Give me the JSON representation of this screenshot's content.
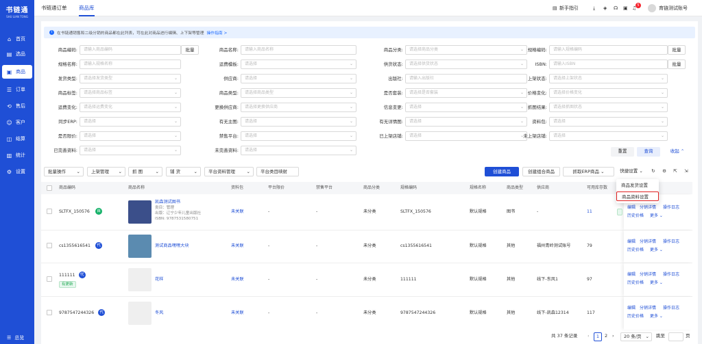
{
  "app": {
    "logo": "书链通",
    "logo_sub": "SHU LIAN TONG"
  },
  "sidebar": {
    "items": [
      {
        "label": "首页",
        "icon": "home-icon"
      },
      {
        "label": "选品",
        "icon": "select-icon"
      },
      {
        "label": "商品",
        "icon": "goods-icon"
      },
      {
        "label": "订单",
        "icon": "order-icon"
      },
      {
        "label": "售后",
        "icon": "aftersale-icon"
      },
      {
        "label": "客户",
        "icon": "customer-icon"
      },
      {
        "label": "结算",
        "icon": "settle-icon"
      },
      {
        "label": "统计",
        "icon": "stats-icon"
      },
      {
        "label": "设置",
        "icon": "settings-icon"
      }
    ],
    "active": "商品",
    "collapse_label": "总览"
  },
  "topbar": {
    "tabs": [
      "书链通订单",
      "商品库"
    ],
    "active_tab": "商品库",
    "guide": "新手指引",
    "notification_count": "5",
    "account": "育链测试账号"
  },
  "tip": {
    "text": "在书链通销售和二级分销的商品都在此列表，可在此对商品进行编辑、上下架等管理",
    "link": "操作指南 >"
  },
  "filters": {
    "rows": [
      [
        {
          "label": "商品编码:",
          "placeholder": "请输入商品编码",
          "extra": "批量"
        },
        {
          "label": "商品名称:",
          "placeholder": "请输入商品名称"
        },
        {
          "label": "商品分类:",
          "placeholder": "请选择商品分类",
          "dd": true
        },
        {
          "label": "规格编码:",
          "placeholder": "请输入规格编码",
          "extra": "批量"
        }
      ],
      [
        {
          "label": "规格名称:",
          "placeholder": "请输入规格名称"
        },
        {
          "label": "运费模板:",
          "placeholder": "请选择",
          "dd": true
        },
        {
          "label": "供货状态:",
          "placeholder": "请选择供货状态",
          "dd": true
        },
        {
          "label": "ISBN:",
          "placeholder": "请输入ISBN",
          "extra": "批量"
        }
      ],
      [
        {
          "label": "发货类型:",
          "placeholder": "请选择发货类型",
          "dd": true
        },
        {
          "label": "供应商:",
          "placeholder": "请选择",
          "dd": true
        },
        {
          "label": "出版社:",
          "placeholder": "请输入出版社"
        },
        {
          "label": "上架状态:",
          "placeholder": "请选择上架状态",
          "dd": true
        }
      ],
      [
        {
          "label": "商品标签:",
          "placeholder": "请选择商品标签",
          "dd": true
        },
        {
          "label": "商品类型:",
          "placeholder": "请选择商品类型",
          "dd": true
        },
        {
          "label": "是否套装:",
          "placeholder": "请选择是否套装",
          "dd": true
        },
        {
          "label": "价格变化:",
          "placeholder": "请选择价格变化",
          "dd": true
        }
      ],
      [
        {
          "label": "运费变化:",
          "placeholder": "请选择运费变化",
          "dd": true
        },
        {
          "label": "更换供应商:",
          "placeholder": "请选择更换供应商",
          "dd": true
        },
        {
          "label": "信息变更:",
          "placeholder": "请选择",
          "dd": true
        },
        {
          "label": "抓图结果:",
          "placeholder": "请选择抓图状态",
          "dd": true
        }
      ],
      [
        {
          "label": "同步ERP:",
          "placeholder": "请选择",
          "dd": true
        },
        {
          "label": "有无主图:",
          "placeholder": "请选择",
          "dd": true
        },
        {
          "label": "有无详情图:",
          "placeholder": "请选择",
          "dd": true
        },
        {
          "label": "资料包:",
          "placeholder": "请选择",
          "dd": true
        }
      ],
      [
        {
          "label": "是否限价:",
          "placeholder": "请选择",
          "dd": true
        },
        {
          "label": "禁售平台:",
          "placeholder": "请选择",
          "dd": true
        },
        {
          "label": "已上架店铺:",
          "placeholder": "请选择",
          "dd": true
        },
        {
          "label": "未上架店铺:",
          "placeholder": "请选择",
          "dd": true
        }
      ],
      [
        {
          "label": "已完善资料:",
          "placeholder": "请选择",
          "dd": true
        },
        {
          "label": "未完善资料:",
          "placeholder": "请选择",
          "dd": true
        }
      ]
    ],
    "reset": "重置",
    "search": "查询",
    "collapse": "收起"
  },
  "toolbar": {
    "left": [
      "批量操作",
      "上架管理",
      "抓 图",
      "铺 货",
      "平台资料管理",
      "平台类目映射"
    ],
    "create": "创建商品",
    "create_combo": "创建组合商品",
    "grab_erp": "抓取ERP商品",
    "quick": "快捷设置"
  },
  "quick_menu": [
    "商品发货设置",
    "商品资料设置"
  ],
  "table": {
    "headers": [
      "商品编码",
      "商品名称",
      "资料包",
      "平台限价",
      "禁售平台",
      "商品分类",
      "规格编码",
      "规格名称",
      "商品类型",
      "供应商",
      "可用库存数"
    ],
    "rows": [
      {
        "code": "SLTFX_150576",
        "tag": "自",
        "name": "凯森测试图书",
        "meta": [
          "类目：管理",
          "出版：辽宁少年儿童出版社",
          "ISBN: 9787531580751"
        ],
        "pkg": "未关联",
        "limit": "-",
        "ban": "-",
        "cat": "未分类",
        "skucode": "SLTFX_150576",
        "sku": "默认规格",
        "type": "图书",
        "supplier": "-",
        "stock": "11"
      },
      {
        "code": "cs1355616541",
        "tag": "代",
        "name": "测试商品嘿嘿大块",
        "meta": [],
        "pkg": "未关联",
        "limit": "-",
        "ban": "-",
        "cat": "未分类",
        "skucode": "cs1355616541",
        "sku": "默认规格",
        "type": "其他",
        "supplier": "福州青岭测试账号",
        "stock": "79"
      },
      {
        "code": "111111",
        "tag": "代",
        "status": "有更新",
        "name": "花样",
        "meta": [],
        "pkg": "未关联",
        "limit": "-",
        "ban": "-",
        "cat": "未分类",
        "skucode": "111111",
        "sku": "默认规格",
        "type": "其他",
        "supplier": "线下-东风1",
        "stock": "97"
      },
      {
        "code": "9787547244326",
        "tag": "代",
        "name": "冬风",
        "meta": [],
        "pkg": "未关联",
        "limit": "-",
        "ban": "-",
        "cat": "未分类",
        "skucode": "9787547244326",
        "sku": "默认规格",
        "type": "其他",
        "supplier": "线下-凯森12314",
        "stock": "117"
      }
    ],
    "ops": {
      "edit": "编辑",
      "dist": "分销详情",
      "log": "操作日志",
      "price": "历史价格",
      "more": "更多"
    }
  },
  "pagination": {
    "total": "共 37 条记录",
    "pages": [
      "1",
      "2"
    ],
    "current": "1",
    "size": "20 条/页",
    "goto": "跳至",
    "goto_after": "页"
  }
}
